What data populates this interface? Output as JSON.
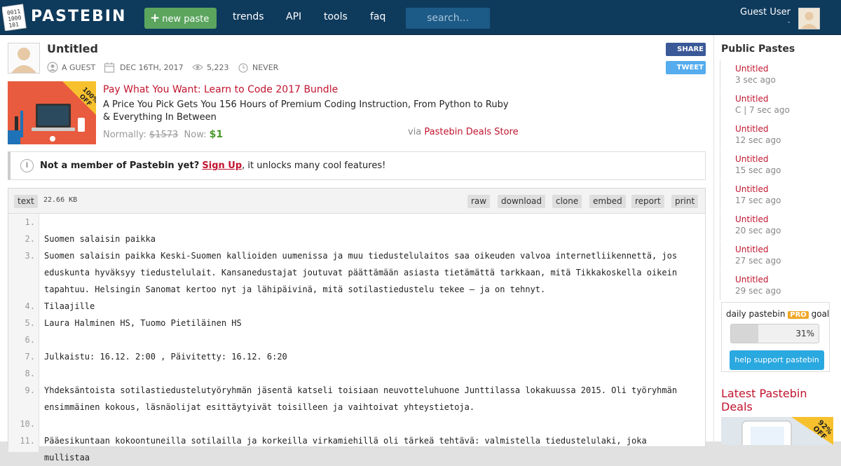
{
  "header": {
    "logo_text": "PASTEBIN",
    "new_paste_label": "new paste",
    "nav": [
      "trends",
      "API",
      "tools",
      "faq"
    ],
    "search_placeholder": "search...",
    "user_name": "Guest User",
    "user_sub": "-"
  },
  "paste": {
    "title": "Untitled",
    "author": "A GUEST",
    "date": "DEC 16TH, 2017",
    "views": "5,223",
    "expires": "NEVER",
    "share_label": "SHARE",
    "tweet_label": "TWEET"
  },
  "ad": {
    "badge": "100% OFF",
    "title": "Pay What You Want: Learn to Code 2017 Bundle",
    "description": "A Price You Pick Gets You 156 Hours of Premium Coding Instruction, From Python to Ruby & Everything In Between",
    "normally_label": "Normally:",
    "normal_price": "$1573",
    "now_label": "Now:",
    "now_price": "$1",
    "via_label": "via",
    "via_link": "Pastebin Deals Store"
  },
  "notice": {
    "bold": "Not a member of Pastebin yet?",
    "link": "Sign Up",
    "rest": ", it unlocks many cool features!"
  },
  "code": {
    "syntax": "text",
    "size": "22.66 KB",
    "buttons": [
      "raw",
      "download",
      "clone",
      "embed",
      "report",
      "print"
    ],
    "lines": [
      {
        "n": "1.",
        "text": ""
      },
      {
        "n": "2.",
        "text": "Suomen salaisin paikka"
      },
      {
        "n": "3.",
        "text": "Suomen salaisin paikka Keski-Suomen kallioiden uumenissa ja muu tiedustelulaitos saa oikeuden valvoa internetliikennettä, jos eduskunta hyväksyy tiedustelulait. Kansanedustajat joutuvat päättämään asiasta tietämättä tarkkaan, mitä Tikkakoskella oikein tapahtuu. Helsingin Sanomat kertoo nyt ja lähipäivinä, mitä sotilastiedustelu tekee – ja on tehnyt."
      },
      {
        "n": "4.",
        "text": "Tilaajille"
      },
      {
        "n": "5.",
        "text": "Laura Halminen HS, Tuomo Pietiläinen HS"
      },
      {
        "n": "6.",
        "text": ""
      },
      {
        "n": "7.",
        "text": "Julkaistu: 16.12. 2:00 , Päivitetty: 16.12. 6:20"
      },
      {
        "n": "8.",
        "text": ""
      },
      {
        "n": "9.",
        "text": "Yhdeksäntoista sotilastiedustelutyöryhmän jäsentä katseli toisiaan neuvotteluhuone Junttilassa lokakuussa 2015. Oli työryhmän ensimmäinen kokous, läsnäolijat esittäytyivät toisilleen ja vaihtoivat yhteystietoja."
      },
      {
        "n": "10.",
        "text": ""
      },
      {
        "n": "11.",
        "text": "Pääesikuntaan kokoontuneilla sotilailla ja korkeilla virkamiehillä oli tärkeä tehtävä: valmistella tiedustelulaki, joka mullistaa"
      }
    ]
  },
  "sidebar": {
    "public_pastes_heading": "Public Pastes",
    "pastes": [
      {
        "title": "Untitled",
        "meta": "3 sec ago"
      },
      {
        "title": "Untitled",
        "meta": "C | 7 sec ago"
      },
      {
        "title": "Untitled",
        "meta": "12 sec ago"
      },
      {
        "title": "Untitled",
        "meta": "15 sec ago"
      },
      {
        "title": "Untitled",
        "meta": "17 sec ago"
      },
      {
        "title": "Untitled",
        "meta": "20 sec ago"
      },
      {
        "title": "Untitled",
        "meta": "27 sec ago"
      },
      {
        "title": "Untitled",
        "meta": "29 sec ago"
      }
    ],
    "goal_prefix": "daily pastebin",
    "goal_pro": "PRO",
    "goal_suffix": "goal",
    "goal_percent": 31,
    "goal_percent_label": "31%",
    "support_label": "help support pastebin",
    "deals_heading": "Latest Pastebin Deals",
    "deals_badge": "92% OFF"
  },
  "colors": {
    "topbar": "#0e3a5c",
    "accent": "#c1142e",
    "new_paste": "#5ba55f",
    "share": "#3b5998",
    "tweet": "#55acee"
  }
}
